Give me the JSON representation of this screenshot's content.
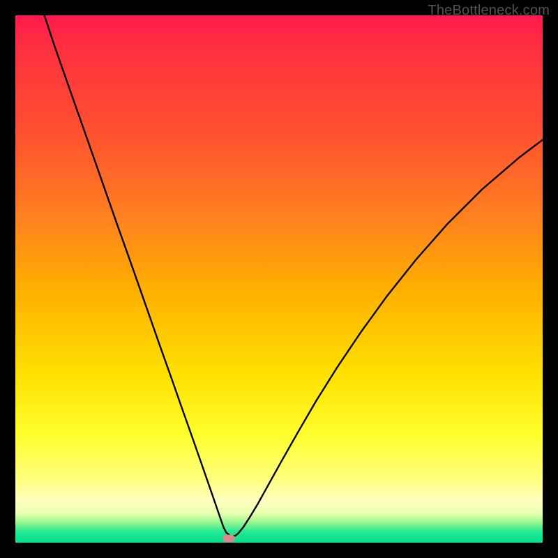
{
  "watermark": "TheBottleneck.com",
  "marker": {
    "x_frac": 0.405,
    "y_frac": 0.992
  },
  "chart_data": {
    "type": "line",
    "title": "",
    "xlabel": "",
    "ylabel": "",
    "xlim": [
      0,
      1
    ],
    "ylim": [
      0,
      1
    ],
    "x": [
      0.055,
      0.075,
      0.095,
      0.115,
      0.135,
      0.155,
      0.175,
      0.195,
      0.215,
      0.235,
      0.255,
      0.275,
      0.295,
      0.315,
      0.335,
      0.355,
      0.37,
      0.38,
      0.39,
      0.395,
      0.4,
      0.408,
      0.417,
      0.423,
      0.432,
      0.445,
      0.46,
      0.48,
      0.505,
      0.535,
      0.57,
      0.61,
      0.655,
      0.705,
      0.76,
      0.82,
      0.885,
      0.955,
      1.0
    ],
    "y": [
      1.0,
      0.94,
      0.883,
      0.826,
      0.769,
      0.712,
      0.655,
      0.598,
      0.542,
      0.485,
      0.428,
      0.371,
      0.315,
      0.258,
      0.201,
      0.144,
      0.101,
      0.072,
      0.043,
      0.029,
      0.019,
      0.013,
      0.013,
      0.018,
      0.029,
      0.049,
      0.074,
      0.11,
      0.155,
      0.208,
      0.268,
      0.332,
      0.399,
      0.468,
      0.537,
      0.605,
      0.67,
      0.73,
      0.764
    ],
    "notes": "V-shaped bottleneck curve; background gradient green (bottom) → yellow → orange → red (top). Small pink marker at curve minimum.",
    "colors": {
      "curve": "#000000",
      "marker": "#d98a88",
      "gradient_top": "#ff1a4d",
      "gradient_bottom": "#00e08a"
    }
  }
}
